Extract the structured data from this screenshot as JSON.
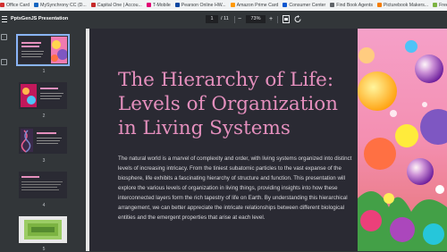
{
  "bookmarks": [
    {
      "label": "Office Card",
      "color": "#d32f2f"
    },
    {
      "label": "MySynchrony CC (D...",
      "color": "#1565c0"
    },
    {
      "label": "Capital One | Accou...",
      "color": "#c62828"
    },
    {
      "label": "T-Mobile",
      "color": "#e20074"
    },
    {
      "label": "Pearson Online HW...",
      "color": "#0d47a1"
    },
    {
      "label": "Amazon Prime Card",
      "color": "#ff9900"
    },
    {
      "label": "Consumer Center",
      "color": "#0b57d0"
    },
    {
      "label": "Find Book Agents",
      "color": "#5f6368"
    },
    {
      "label": "Picturebook Makers...",
      "color": "#f57c00"
    },
    {
      "label": "Free Slide...",
      "color": "#7cb342"
    }
  ],
  "toolbar": {
    "doc_title": "PptxGenJS Presentation",
    "current_page": "1",
    "total_pages": "/ 11",
    "zoom": "73%",
    "zoom_out": "−",
    "zoom_in": "+"
  },
  "sidebar": {
    "pages": [
      {
        "label": "1",
        "active": true
      },
      {
        "label": "2",
        "active": false
      },
      {
        "label": "3",
        "active": false
      },
      {
        "label": "4",
        "active": false
      },
      {
        "label": "5",
        "active": false
      }
    ]
  },
  "slide": {
    "title": "The Hierarchy of Life: Levels of Organization in Living Systems",
    "body": "The natural world is a marvel of complexity and order, with living systems organized into distinct levels of increasing intricacy. From the tiniest subatomic particles to the vast expanse of the biosphere, life exhibits a fascinating hierarchy of structure and function. This presentation will explore the various levels of organization in living things, providing insights into how these interconnected layers form the rich tapestry of life on Earth. By understanding this hierarchical arrangement, we can better appreciate the intricate relationships between different biological entities and the emergent properties that arise at each level."
  },
  "colors": {
    "title": "#e48fbd",
    "viewer_bg": "#2a2a33",
    "toolbar_bg": "#323639",
    "active_outline": "#8ab4f8"
  },
  "icons": [
    "menu-icon",
    "fit-page-icon",
    "rotate-icon",
    "thumbnails-icon",
    "outline-icon"
  ]
}
